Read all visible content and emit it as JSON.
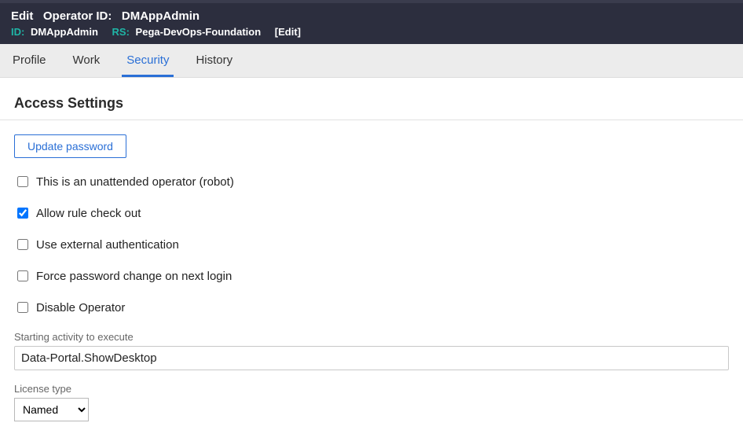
{
  "header": {
    "title_prefix": "Edit",
    "title_type": "Operator ID:",
    "title_name": "DMAppAdmin",
    "id_label": "ID:",
    "id_value": "DMAppAdmin",
    "rs_label": "RS:",
    "rs_value": "Pega-DevOps-Foundation",
    "edit_link": "[Edit]"
  },
  "tabs": [
    {
      "label": "Profile",
      "active": false
    },
    {
      "label": "Work",
      "active": false
    },
    {
      "label": "Security",
      "active": true
    },
    {
      "label": "History",
      "active": false
    }
  ],
  "section": {
    "title": "Access Settings",
    "update_password_label": "Update password",
    "checkboxes": [
      {
        "label": "This is an unattended operator (robot)",
        "checked": false,
        "name": "unattended-operator"
      },
      {
        "label": "Allow rule check out",
        "checked": true,
        "name": "allow-rule-checkout"
      },
      {
        "label": "Use external authentication",
        "checked": false,
        "name": "external-auth"
      },
      {
        "label": "Force password change on next login",
        "checked": false,
        "name": "force-pw-change"
      },
      {
        "label": "Disable Operator",
        "checked": false,
        "name": "disable-operator"
      }
    ],
    "starting_activity": {
      "label": "Starting activity to execute",
      "value": "Data-Portal.ShowDesktop"
    },
    "license_type": {
      "label": "License type",
      "value": "Named",
      "options": [
        "Named"
      ]
    }
  }
}
